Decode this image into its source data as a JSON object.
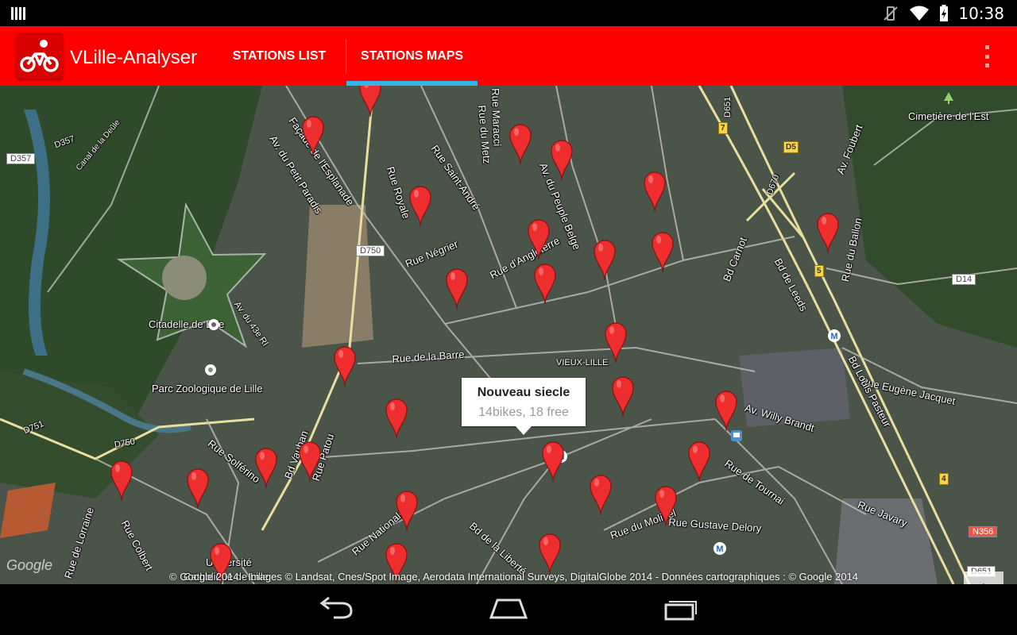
{
  "status_bar": {
    "time": "10:38"
  },
  "action_bar": {
    "app_title": "VLille-Analyser",
    "tabs": [
      {
        "label": "STATIONS LIST"
      },
      {
        "label": "STATIONS MAPS"
      }
    ],
    "active_tab": "STATIONS MAPS",
    "accent_color": "#ff0000",
    "indicator_color": "#33b5e5"
  },
  "map": {
    "labels": {
      "citadelle": "Citadelle de Lille",
      "zoo": "Parc Zoologique de Lille",
      "cimetiere": "Cimetière de l'Est",
      "vieux_lille": "VIEUX-LILLE",
      "universite": "Université",
      "catholique": "Catholique de Lille",
      "rue_barre": "Rue de la Barre",
      "rue_negrier": "Rue Négrier",
      "rue_royale": "Rue Royale",
      "rue_saint_andre": "Rue Saint-André",
      "av_peuple_belge": "Av. du Peuple Belge",
      "rue_metz": "Rue du Metz",
      "rue_maracci": "Rue Maracci",
      "rue_angleterre": "Rue d'Angleterre",
      "av_petit_paradis": "Av. du Petit Paradis",
      "facade_esplanade": "Façade de l'Esplanade",
      "bd_vauban": "Bd Vauban",
      "rue_patou": "Rue Patou",
      "rue_solferino": "Rue Solférino",
      "rue_colbert": "Rue Colbert",
      "rue_lorraine": "Rue de Lorraine",
      "rue_nationale": "Rue Nationale",
      "bd_liberte": "Bd de la Liberté",
      "rue_molinel": "Rue du Molinel",
      "rue_gustave_delory": "Rue Gustave Delory",
      "rue_tournai": "Rue de Tournai",
      "rue_javary": "Rue Javary",
      "av_willy_brandt": "Av. Willy Brandt",
      "rue_eugene_jacquet": "Rue Eugène Jacquet",
      "bd_louis_pasteur": "Bd Louis Pasteur",
      "bd_leeds": "Bd de Leeds",
      "bd_carnot": "Bd Carnot",
      "rue_ballon": "Rue du Ballon",
      "av_foubert": "Av. Foubert",
      "canal_deule": "Canal de la Deûle",
      "d357": "D357",
      "d357_road": "D357",
      "d750": "D750",
      "d750_road": "D750",
      "d751": "D751",
      "d651": "D651",
      "d5": "D5",
      "d670": "D670",
      "d14": "D14",
      "n356": "N356",
      "d651_bottom": "D651",
      "r7": "7",
      "r5": "5",
      "r4": "4",
      "ri_av": "Av. du 43e RI"
    },
    "marker_color": "#ee2e2e",
    "info_window": {
      "title": "Nouveau siecle",
      "subtitle": "14bikes, 18 free"
    },
    "zoom_in": "+",
    "zoom_out": "−",
    "google_logo": "Google",
    "copyright": "© Google 2014 - Images © Landsat, Cnes/Spot Image, Aerodata International Surveys, DigitalGlobe 2014 - Données cartographiques : © Google 2014"
  }
}
